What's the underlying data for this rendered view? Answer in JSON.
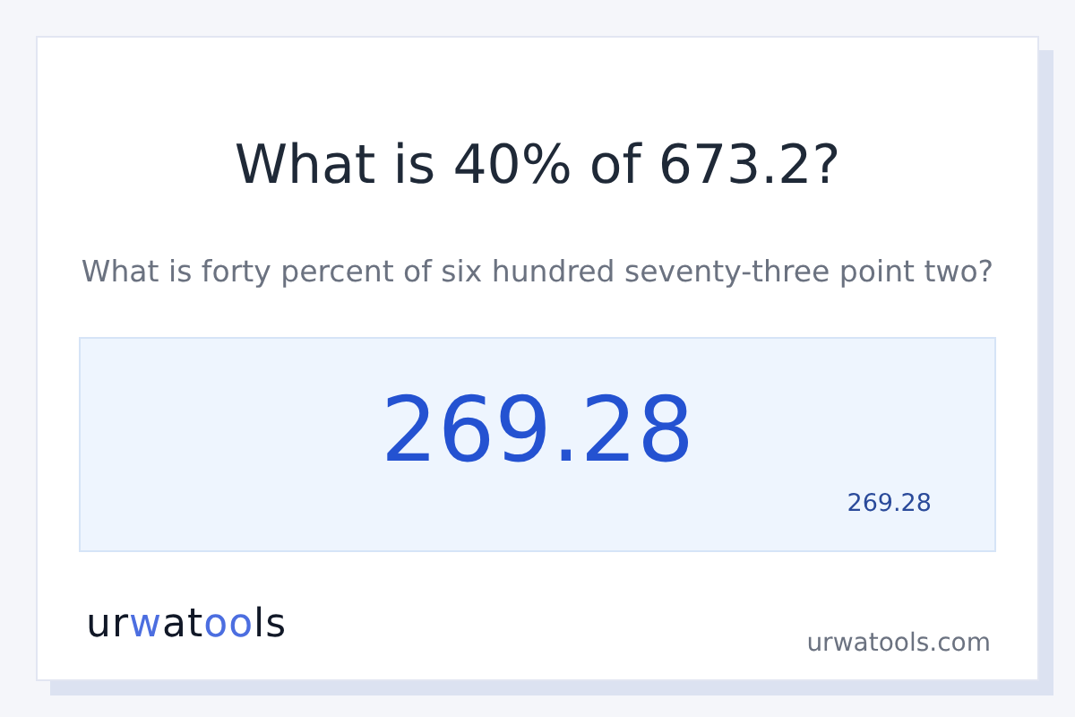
{
  "title": "What is 40% of 673.2?",
  "subtitle": "What is forty percent of six hundred seventy-three point two?",
  "result": {
    "value": "269.28",
    "small_value": "269.28"
  },
  "logo": [
    {
      "text": "ur",
      "accent": false
    },
    {
      "text": "w",
      "accent": true
    },
    {
      "text": "at",
      "accent": false
    },
    {
      "text": "oo",
      "accent": true
    },
    {
      "text": "ls",
      "accent": false
    }
  ],
  "site": "urwatools.com"
}
